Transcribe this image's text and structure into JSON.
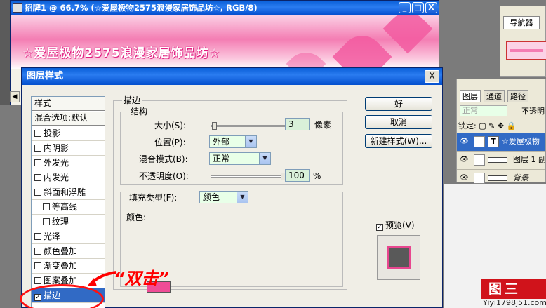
{
  "document": {
    "title": "招牌1 @ 66.7% (☆爱屋极物2575浪漫家居饰品坊☆, RGB/8)",
    "banner_text": "☆爱屋极物2575浪漫家居饰品坊☆",
    "window_buttons": [
      "_",
      "□",
      "X"
    ]
  },
  "navigator": {
    "tab": "导航器"
  },
  "layers_panel": {
    "tabs": [
      "图层",
      "通道",
      "路径"
    ],
    "blend_mode": "正常",
    "opacity_label": "不透明",
    "lock_label": "锁定:",
    "layers": [
      {
        "name": "☆爱屋极物",
        "type": "T",
        "selected": true
      },
      {
        "name": "图层 1 副",
        "type": "shape",
        "selected": false
      },
      {
        "name": "背景",
        "type": "bg",
        "selected": false
      }
    ]
  },
  "dialog": {
    "title": "图层样式",
    "close": "X",
    "styles_header": "样式",
    "blend_options": "混合选项:默认",
    "style_items": [
      {
        "label": "投影",
        "checked": false,
        "sub": false
      },
      {
        "label": "内阴影",
        "checked": false,
        "sub": false
      },
      {
        "label": "外发光",
        "checked": false,
        "sub": false
      },
      {
        "label": "内发光",
        "checked": false,
        "sub": false
      },
      {
        "label": "斜面和浮雕",
        "checked": false,
        "sub": false
      },
      {
        "label": "等高线",
        "checked": false,
        "sub": true
      },
      {
        "label": "纹理",
        "checked": false,
        "sub": true
      },
      {
        "label": "光泽",
        "checked": false,
        "sub": false
      },
      {
        "label": "颜色叠加",
        "checked": false,
        "sub": false
      },
      {
        "label": "渐变叠加",
        "checked": false,
        "sub": false
      },
      {
        "label": "图案叠加",
        "checked": false,
        "sub": false
      },
      {
        "label": "描边",
        "checked": true,
        "sub": false
      }
    ],
    "stroke": {
      "group_label": "描边",
      "structure_label": "结构",
      "size_label": "大小(S):",
      "size_value": "3",
      "size_unit": "像素",
      "size_slider": 0.02,
      "position_label": "位置(P):",
      "position_value": "外部",
      "blend_label": "混合模式(B):",
      "blend_value": "正常",
      "opacity_label": "不透明度(O):",
      "opacity_value": "100",
      "opacity_unit": "%",
      "opacity_slider": 1.0,
      "fill_type_label": "填充类型(F):",
      "fill_type_value": "颜色",
      "color_label": "颜色:",
      "color": "#ef4c96"
    },
    "buttons": {
      "ok": "好",
      "cancel": "取消",
      "new_style": "新建样式(W)...",
      "preview": "预览(V)",
      "preview_checked": true
    }
  },
  "annotation": {
    "text": "“双击”",
    "color": "#ff0000"
  },
  "watermark": {
    "logo": "图三",
    "url": "Yiyi1798j51.com"
  }
}
